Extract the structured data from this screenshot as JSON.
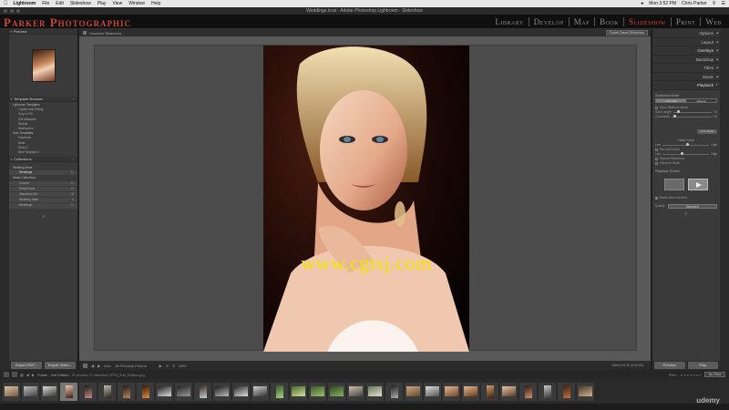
{
  "menubar": {
    "app": "Lightroom",
    "items": [
      "File",
      "Edit",
      "Slideshow",
      "Play",
      "View",
      "Window",
      "Help"
    ],
    "time": "Mon 3:52 PM",
    "user": "Chris Parker"
  },
  "window_title": "Weddings.lrcat - Adobe Photoshop Lightroom - Slideshow",
  "identity_plate": "Parker Photographic",
  "modules": [
    "Library",
    "Develop",
    "Map",
    "Book",
    "Slideshow",
    "Print",
    "Web"
  ],
  "active_module": "Slideshow",
  "left_panel": {
    "preview_header": "Preview",
    "template_browser_header": "Template Browser",
    "templates": [
      {
        "label": "Lightroom Templates",
        "type": "folder"
      },
      {
        "label": "Caption and Rating",
        "type": "item"
      },
      {
        "label": "Crop to Fill",
        "type": "item"
      },
      {
        "label": "Exif Metadata",
        "type": "item"
      },
      {
        "label": "Default",
        "type": "item"
      },
      {
        "label": "Widescreen",
        "type": "item"
      },
      {
        "label": "User Templates",
        "type": "folder"
      },
      {
        "label": "Facebook",
        "type": "item"
      },
      {
        "label": "Bride",
        "type": "item"
      },
      {
        "label": "Show 2",
        "type": "item"
      },
      {
        "label": "New Template 2",
        "type": "item"
      }
    ],
    "collections_header": "Collections",
    "collections": [
      {
        "label": "Wedding Ideas",
        "count": "",
        "type": "folder"
      },
      {
        "label": "Weddings",
        "count": "31",
        "type": "coll",
        "selected": true
      },
      {
        "label": "Smart Collections",
        "count": "",
        "type": "folder"
      },
      {
        "label": "Colored",
        "count": "12",
        "type": "coll"
      },
      {
        "label": "Detail Shots",
        "count": "10",
        "type": "coll"
      },
      {
        "label": "Slideshow Set",
        "count": "18",
        "type": "coll"
      },
      {
        "label": "Wedding Table",
        "count": "6",
        "type": "coll"
      },
      {
        "label": "Weddings",
        "count": "24",
        "type": "coll"
      }
    ],
    "export_pdf": "Export PDF...",
    "export_video": "Export Video..."
  },
  "center": {
    "slideshow_name": "Unsaved Slideshow",
    "create_button": "Create Saved Slideshow",
    "watermark": "www.cgtsj.com",
    "toolbar_use": "Use:",
    "toolbar_use_value": "All Filmstrip Photos",
    "toolbar_abc": "ABC",
    "toolbar_right": "Slide 6 of 31 (0:00:00)"
  },
  "right_panel": {
    "sections": [
      "Options",
      "Layout",
      "Overlays",
      "Backdrop",
      "Titles",
      "Music",
      "Playback"
    ],
    "slideshow_mode_label": "Slideshow Mode",
    "modes": [
      "Automatic",
      "Manual"
    ],
    "sync_label": "Sync Slides to Music",
    "slide_length_label": "Slide Length",
    "slide_length_value": "7.8",
    "crossfades_label": "Crossfades",
    "crossfades_value": "0.5",
    "fit_button": "Fit to Music",
    "fade_label": "Fade Color",
    "pan_zoom_label": "Pan and Zoom",
    "low_high": [
      "Low",
      "High"
    ],
    "repeat_label": "Repeat Slideshow",
    "random_label": "Random Order",
    "playback_screen_label": "Playback Screen",
    "blank_other_label": "Blank other screens",
    "quality_label": "Quality",
    "quality_value": "Standard",
    "preview_button": "Preview",
    "play_button": "Play"
  },
  "filmbar": {
    "source": "Folder : 2nd Edition",
    "count_text": "31 photos / 1 selected / ETS_2nd_Edition.jpg",
    "filter_label": "Filter :",
    "filter_value": "No Filter"
  },
  "filmstrip": {
    "thumbs": [
      {
        "c1": "#d8c2a8",
        "c2": "#7a5a40",
        "port": false
      },
      {
        "c1": "#b9b9b9",
        "c2": "#444",
        "port": false
      },
      {
        "c1": "#e0dcd6",
        "c2": "#333",
        "port": false
      },
      {
        "c1": "#e9c9ae",
        "c2": "#3a1a10",
        "port": true,
        "sel": true
      },
      {
        "c1": "#1a1a1a",
        "c2": "#c88",
        "port": true
      },
      {
        "c1": "#c6b8a8",
        "c2": "#222",
        "port": true
      },
      {
        "c1": "#221a16",
        "c2": "#b8845c",
        "port": true
      },
      {
        "c1": "#2a1a10",
        "c2": "#e08a40",
        "port": true
      },
      {
        "c1": "#1e1e1e",
        "c2": "#ddd",
        "port": false
      },
      {
        "c1": "#222",
        "c2": "#999",
        "port": false
      },
      {
        "c1": "#3a2a20",
        "c2": "#ccc",
        "port": true
      },
      {
        "c1": "#1a1a1a",
        "c2": "#bbb",
        "port": false
      },
      {
        "c1": "#2a2a2a",
        "c2": "#ddd",
        "port": false
      },
      {
        "c1": "#cfcfcf",
        "c2": "#333",
        "port": false
      },
      {
        "c1": "#3a5a2a",
        "c2": "#aad080",
        "port": true
      },
      {
        "c1": "#4a6a2a",
        "c2": "#cfe0a0",
        "port": false
      },
      {
        "c1": "#3a5a2a",
        "c2": "#9fc070",
        "port": false
      },
      {
        "c1": "#2a4a20",
        "c2": "#8ab060",
        "port": false
      },
      {
        "c1": "#d0c0a8",
        "c2": "#444",
        "port": false
      },
      {
        "c1": "#6a7a5a",
        "c2": "#e0e0d0",
        "port": false
      },
      {
        "c1": "#222",
        "c2": "#aaa",
        "port": true
      },
      {
        "c1": "#c8a880",
        "c2": "#6a4a30",
        "port": false
      },
      {
        "c1": "#ddd",
        "c2": "#555",
        "port": false
      },
      {
        "c1": "#d8b898",
        "c2": "#7a4a2a",
        "port": false
      },
      {
        "c1": "#e0b890",
        "c2": "#6a3a20",
        "port": false
      },
      {
        "c1": "#d09a70",
        "c2": "#3a2010",
        "port": true
      },
      {
        "c1": "#e8c8a8",
        "c2": "#5a3a2a",
        "port": false
      },
      {
        "c1": "#2a1a12",
        "c2": "#d09070",
        "port": true
      },
      {
        "c1": "#c8c8c8",
        "c2": "#333",
        "port": true
      },
      {
        "c1": "#3a2018",
        "c2": "#c07040",
        "port": true
      },
      {
        "c1": "#4a3a30",
        "c2": "#d0b090",
        "port": false
      }
    ]
  },
  "branding": "udemy"
}
